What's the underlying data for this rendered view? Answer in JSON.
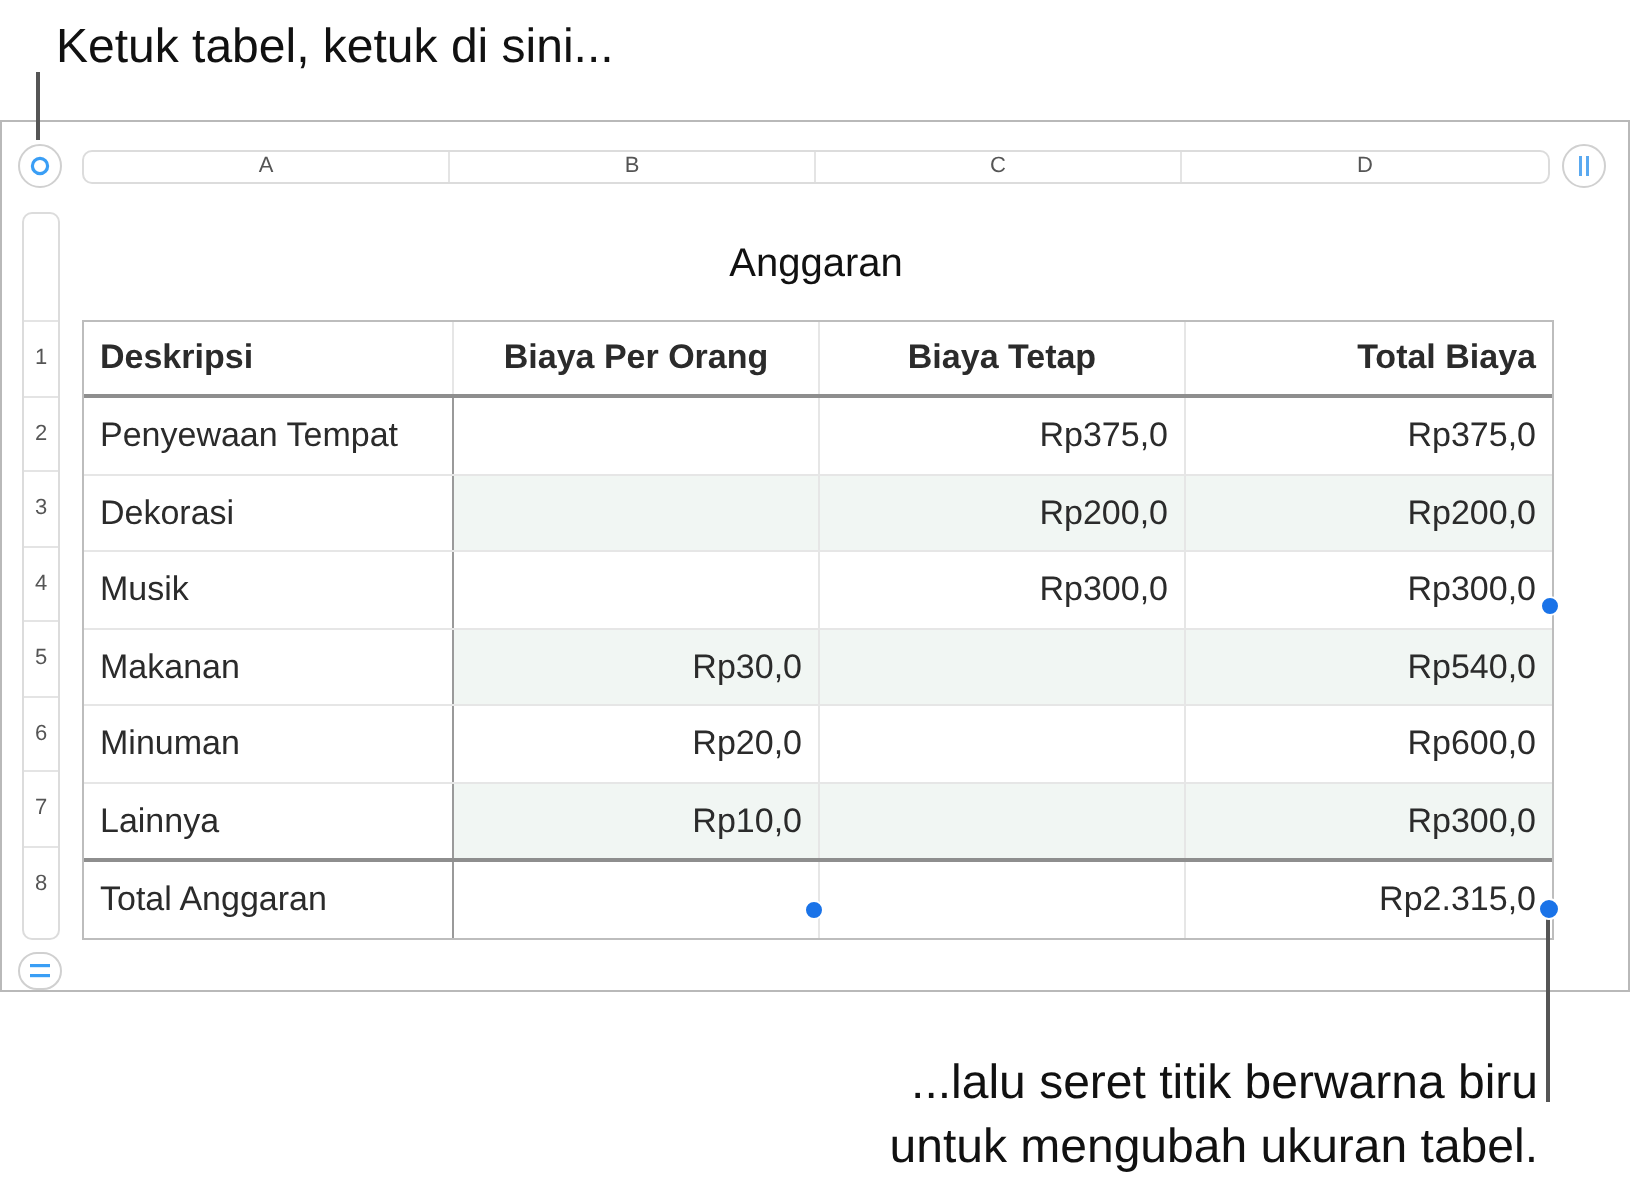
{
  "callout_top": "Ketuk tabel, ketuk di sini...",
  "column_headers": [
    "A",
    "B",
    "C",
    "D"
  ],
  "row_headers": [
    "1",
    "2",
    "3",
    "4",
    "5",
    "6",
    "7",
    "8"
  ],
  "table": {
    "title": "Anggaran",
    "columns": [
      "Deskripsi",
      "Biaya Per Orang",
      "Biaya Tetap",
      "Total Biaya"
    ],
    "rows": [
      {
        "description": "Penyewaan Tempat",
        "fixed_cost": "Rp375,0",
        "total": "Rp375,0",
        "shaded": false
      },
      {
        "description": "Dekorasi",
        "fixed_cost": "Rp200,0",
        "total": "Rp200,0",
        "shaded": true
      },
      {
        "description": "Musik",
        "fixed_cost": "Rp300,0",
        "total": "Rp300,0",
        "shaded": false
      },
      {
        "description": "Makanan",
        "per_person": "Rp30,0",
        "total": "Rp540,0",
        "shaded": true
      },
      {
        "description": "Minuman",
        "per_person": "Rp20,0",
        "total": "Rp600,0",
        "shaded": false
      },
      {
        "description": "Lainnya",
        "per_person": "Rp10,0",
        "total": "Rp300,0",
        "shaded": true
      }
    ],
    "footer": {
      "description": "Total Anggaran",
      "total": "Rp2.315,0"
    }
  },
  "callout_bottom": [
    "...lalu seret titik berwarna biru",
    "untuk mengubah ukuran tabel."
  ]
}
